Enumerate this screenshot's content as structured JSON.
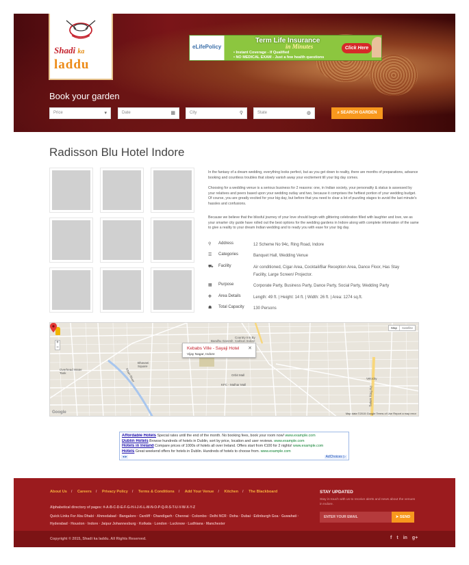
{
  "brand": {
    "line1": "Shadi",
    "line1_ka": "ka",
    "line2": "laddu"
  },
  "ad_banner": {
    "brand": "eLifePolicy",
    "headline": "Term Life Insurance",
    "subheadline": "in Minutes",
    "bullet1": "• Instant Coverage - If Qualified",
    "bullet2": "• NO MEDICAL EXAM - Just a few health questions",
    "cta": "Click Here",
    "cta_small": "Free Quote"
  },
  "search": {
    "title": "Book your garden",
    "price_placeholder": "Price",
    "date_placeholder": "Date",
    "city_placeholder": "City",
    "state_placeholder": "State",
    "button_label": "SEARCH GARDEN"
  },
  "hotel": {
    "name": "Radisson Blu Hotel Indore",
    "description": [
      "In the fantasy of a dream wedding, everything looks perfect, but as you get down to reality, there are months of preparations, advance booking and countless troubles that slowly vanish away your excitement till your big day comes.",
      "Choosing for a wedding venue is a serious business for 2 reasons: one, in Indian society, your personality & status is assessed by your relatives and peers based upon your wedding outlay and two, because it comprises the heftiest portion of your wedding budget. Of course, you are greatly excited for your big day, but before that you need to clear a lot of puzzling stages to avoid the last minute's hassles and confusions.",
      "Because we believe that the blissful journey of your love should begin with glittering celebration filled with laughter and love, we as your smarter city guide have rolled out the best options for the wedding gardens in Indore along with complete information of the same to give a reality to your dream Indian wedding and to ready you with ease for your big day."
    ],
    "details": [
      {
        "icon": "map-pin-icon",
        "glyph": "⚲",
        "label": "Address",
        "value": "12 Scheme No 94c, Ring Road, Indore"
      },
      {
        "icon": "list-icon",
        "glyph": "☰",
        "label": "Categories",
        "value": "Banquet Hall, Wedding Venue"
      },
      {
        "icon": "car-icon",
        "glyph": "⛟",
        "label": "Facility",
        "value": "Air conditioned, Cigar Area, Cocktail/Bar Reception Area, Dance Floor, Has Stay Facility, Large Screen/ Projector."
      },
      {
        "icon": "building-icon",
        "glyph": "▦",
        "label": "Purpose",
        "value": "Corporate Party, Business Party, Dance Party, Social Party, Wedding Party"
      },
      {
        "icon": "arrows-icon",
        "glyph": "✥",
        "label": "Area Details",
        "value": "Length: 49 ft. | Height: 14 ft. | Width: 26 ft. | Area: 1274 sq.ft."
      },
      {
        "icon": "users-icon",
        "glyph": "☗",
        "label": "Total Capacity",
        "value": "130 Persons"
      }
    ]
  },
  "map": {
    "type_map": "Map",
    "type_satellite": "Satellite",
    "info_title": "Kebabs Ville - Sayaji Hotel",
    "info_sub": "Vijay Nagar, Indore",
    "labels": {
      "bandhu": "Bandhu Ganesh",
      "country_inn": "Country Inn By Carlson Indore",
      "bhavani": "Bhavani Square",
      "overhead": "Overhead Water Tank",
      "khan_river": "Khan River",
      "orbit": "Orbit Mall",
      "kfc": "KFC - Malhar Mall",
      "velocity": "Velocity",
      "satam_ring": "Satam Ring Rd"
    },
    "google": "Google",
    "footer": "Map data ©2015 Google   Terms of Use   Report a map error"
  },
  "text_ad": {
    "rows": [
      {
        "title": "Affordable Hotels",
        "text": " Special rates until the end of the month. No booking fees, book your room now! ",
        "url": "www.example.com"
      },
      {
        "title": "Dublin Hotels",
        "text": " Browse hundreds of hotels in Dublin, sort by price, location and user reviews. ",
        "url": "www.example.com"
      },
      {
        "title": "Hotels in Ireland",
        "text": " Compare prices of 1000s of hotels all over Ireland. Offers start from €100 for 2 nights! ",
        "url": "www.example.com"
      },
      {
        "title": "Hotels",
        "text": " Great weekend offers for hotels in Dublin. Hundreds of hotels to choose from. ",
        "url": "www.example.com"
      }
    ],
    "arrows": "◂ ▸",
    "adchoices": "AdChoices ▷"
  },
  "footer": {
    "nav": [
      "About Us",
      "Careers",
      "Privacy Policy",
      "Terms & Conditions",
      "Add Your Venue",
      "Kitchen",
      "The Blackboard"
    ],
    "separator": "/",
    "alphabet": "Alphabetical directory of pages: #-A-B-C-D-E-F-G-H-I-J-K-L-M-N-O-P-Q-R-S-T-U-V-W-X-Y-Z",
    "quick_links": "Quick Links For Abu Dhabi · Ahmedabad · Bangalore · Cardiff · Chandigarh · Chennai · Colombo · Delhi NCR · Doha · Dubai · Edinburgh Goa · Guwahati · Hyderabad · Houston · Indore · Jaipur Johannesburg · Kolkata · London · Lucknow · Ludhiana · Manchester",
    "stay_title": "STAY UPDATED",
    "stay_text": "Stay in touch with us to receive alerts and news about the venues in Indore.",
    "email_placeholder": "ENTER YOUR EMAIL",
    "send_label": "SEND",
    "copyright": "Copyright © 2015, Shadi ka laddu. All Rights Reserved.",
    "social": [
      "f",
      "t",
      "in",
      "g+"
    ]
  },
  "colors": {
    "accent": "#f8981d",
    "footer_bg": "#9b1b1e",
    "footer_bottom_bg": "#7c1315",
    "logo_red": "#c4202b",
    "logo_orange": "#ec8a17"
  }
}
